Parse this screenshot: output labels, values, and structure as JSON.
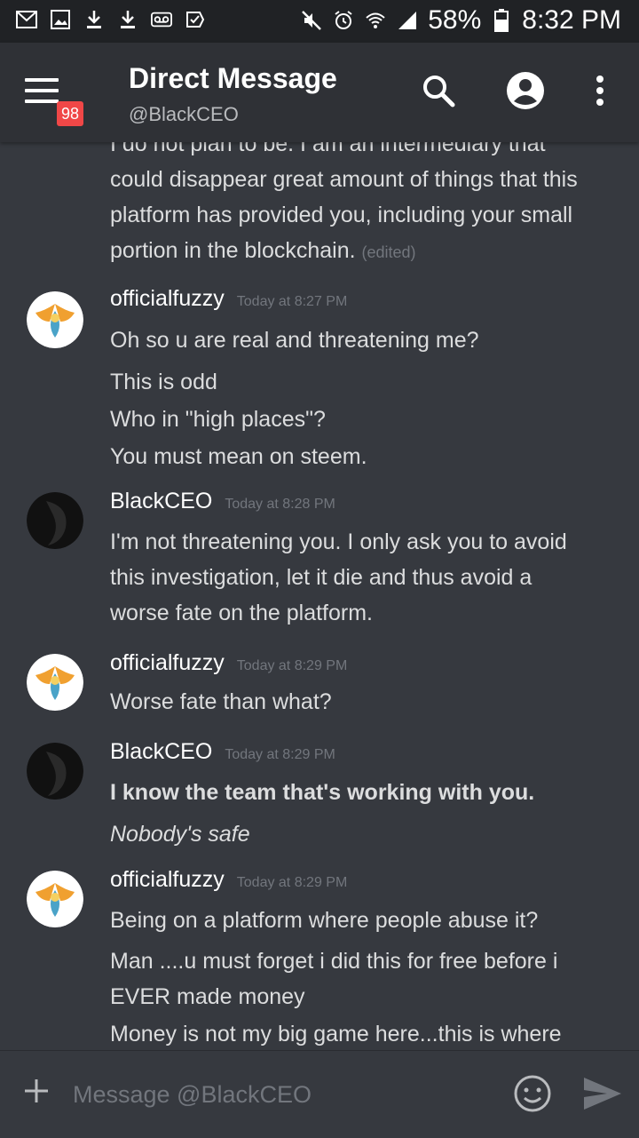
{
  "status_bar": {
    "battery": "58%",
    "time": "8:32 PM",
    "left_icons": [
      "mail-icon",
      "image-icon",
      "download-icon",
      "download-icon",
      "voicemail-icon",
      "check-icon"
    ],
    "right_icons": [
      "mute-icon",
      "alarm-icon",
      "wifi-icon",
      "signal-icon",
      "battery-icon"
    ]
  },
  "header": {
    "title": "Direct Message",
    "subtitle": "@BlackCEO",
    "badge": "98"
  },
  "messages": {
    "continuation": {
      "lines": [
        "I do not plan to be. I am an intermediary that",
        "could disappear great amount of things that this",
        "platform has provided you, including your small",
        "portion in the blockchain."
      ],
      "edited": "(edited)"
    },
    "groups": [
      {
        "author": "officialfuzzy",
        "time": "Today at 8:27 PM",
        "lines": [
          "Oh so u are real and threatening me?",
          "This is odd",
          "Who in \"high places\"?",
          "You must mean on steem."
        ]
      },
      {
        "author": "BlackCEO",
        "time": "Today at 8:28 PM",
        "lines": [
          "I'm not threatening you. I only ask you to avoid",
          "this investigation, let it die and thus avoid a",
          "worse fate on the platform."
        ]
      },
      {
        "author": "officialfuzzy",
        "time": "Today at 8:29 PM",
        "lines": [
          "Worse fate than what?"
        ]
      },
      {
        "author": "BlackCEO",
        "time": "Today at 8:29 PM",
        "lines": [
          "I know the team that's working with you.",
          "Nobody's safe"
        ]
      },
      {
        "author": "officialfuzzy",
        "time": "Today at 8:29 PM",
        "lines": [
          "Being on a platform where people abuse it?",
          "Man ....u must forget i did this for free before i",
          "EVER made money",
          "Money is not my big game here...this is where"
        ]
      }
    ]
  },
  "input": {
    "placeholder": "Message @BlackCEO"
  },
  "colors": {
    "background": "#36393f",
    "header": "#2f3136",
    "statusbar": "#202225",
    "badge": "#f04747"
  }
}
